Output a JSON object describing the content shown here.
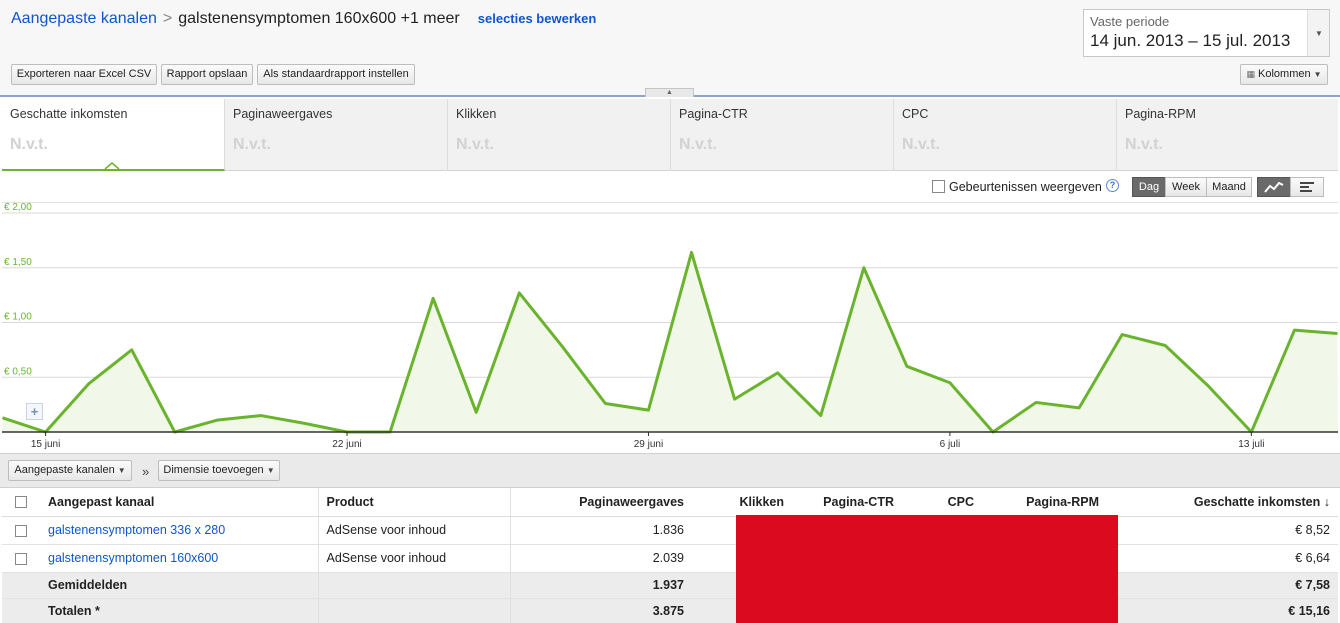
{
  "breadcrumb": {
    "root": "Aangepaste kanalen",
    "separator": ">",
    "current": "galstenensymptomen 160x600 +1 meer",
    "edit_link": "selecties bewerken"
  },
  "period": {
    "label": "Vaste periode",
    "value": "14 jun. 2013 – 15 jul. 2013"
  },
  "toolbar": {
    "export": "Exporteren naar Excel CSV",
    "save": "Rapport opslaan",
    "set_default": "Als standaardrapport instellen",
    "columns": "Kolommen"
  },
  "metric_tabs": [
    {
      "label": "Geschatte inkomsten",
      "value": "N.v.t.",
      "active": true
    },
    {
      "label": "Paginaweergaves",
      "value": "N.v.t."
    },
    {
      "label": "Klikken",
      "value": "N.v.t."
    },
    {
      "label": "Pagina-CTR",
      "value": "N.v.t."
    },
    {
      "label": "CPC",
      "value": "N.v.t."
    },
    {
      "label": "Pagina-RPM",
      "value": "N.v.t."
    }
  ],
  "chart_controls": {
    "events_label": "Gebeurtenissen weergeven",
    "help": "?",
    "granularity": [
      "Dag",
      "Week",
      "Maand"
    ],
    "selected_granularity": "Dag"
  },
  "chart_data": {
    "type": "area",
    "x": [
      "14 jun",
      "15 jun",
      "16 jun",
      "17 jun",
      "18 jun",
      "19 jun",
      "20 jun",
      "21 jun",
      "22 jun",
      "23 jun",
      "24 jun",
      "25 jun",
      "26 jun",
      "27 jun",
      "28 jun",
      "29 jun",
      "30 jun",
      "1 jul",
      "2 jul",
      "3 jul",
      "4 jul",
      "5 jul",
      "6 jul",
      "7 jul",
      "8 jul",
      "9 jul",
      "10 jul",
      "11 jul",
      "12 jul",
      "13 jul",
      "14 jul",
      "15 jul"
    ],
    "series": [
      {
        "values": [
          0.13,
          0.0,
          0.44,
          0.75,
          0.0,
          0.11,
          0.15,
          0.08,
          0.0,
          0.0,
          1.22,
          0.18,
          1.27,
          0.78,
          0.26,
          0.2,
          1.64,
          0.3,
          0.54,
          0.15,
          1.5,
          0.6,
          0.45,
          0.0,
          0.27,
          0.22,
          0.89,
          0.79,
          0.42,
          0.0,
          0.93,
          0.9
        ]
      }
    ],
    "y_ticks": [
      "€ 2,00",
      "€ 1,50",
      "€ 1,00",
      "€ 0,50"
    ],
    "ylim": [
      0,
      2.0
    ],
    "x_ticks": [
      "15 juni",
      "22 juni",
      "29 juni",
      "6 juli",
      "13 juli"
    ],
    "grid": true,
    "line_color": "#6ab42d",
    "fill_color": "#f1f8ea"
  },
  "dimension_bar": {
    "dimension": "Aangepaste kanalen",
    "arrow": "»",
    "add_dimension": "Dimensie toevoegen"
  },
  "table": {
    "headers": [
      "Aangepast kanaal",
      "Product",
      "Paginaweergaves",
      "Klikken",
      "Pagina-CTR",
      "CPC",
      "Pagina-RPM",
      "Geschatte inkomsten ↓"
    ],
    "rows": [
      {
        "channel": "galstenensymptomen 336 x 280",
        "product": "AdSense voor inhoud",
        "pageviews": "1.836",
        "earnings": "€ 8,52"
      },
      {
        "channel": "galstenensymptomen 160x600",
        "product": "AdSense voor inhoud",
        "pageviews": "2.039",
        "earnings": "€ 6,64"
      }
    ],
    "averages": {
      "label": "Gemiddelden",
      "pageviews": "1.937",
      "earnings": "€ 7,58"
    },
    "totals": {
      "label": "Totalen *",
      "pageviews": "3.875",
      "earnings": "€ 15,16"
    },
    "redaction_color": "#dc0a1e"
  }
}
